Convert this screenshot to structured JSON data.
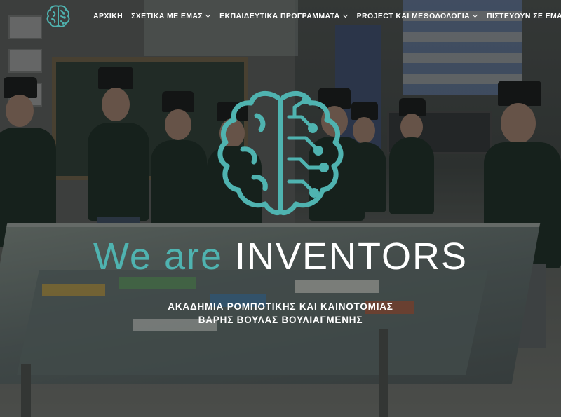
{
  "nav": {
    "items": [
      {
        "label": "ΑΡΧΙΚΗ",
        "has_dropdown": false
      },
      {
        "label": "ΣΧΕΤΙΚΑ ΜΕ ΕΜΑΣ",
        "has_dropdown": true
      },
      {
        "label": "ΕΚΠΑΙΔΕΥΤΙΚΑ ΠΡΟΓΡΑΜΜΑΤΑ",
        "has_dropdown": true
      },
      {
        "label": "PROJECT ΚΑΙ ΜΕΘΟΔΟΛΟΓΙΑ",
        "has_dropdown": true
      },
      {
        "label": "ΠΙΣΤΕΥΟΥΝ ΣΕ ΕΜΑΣ",
        "has_dropdown": false
      }
    ]
  },
  "hero": {
    "headline_part1": "We are",
    "headline_part2": "INVENTORS",
    "subtitle_line1": "ΑΚΑΔΗΜΙΑ ΡΟΜΠΟΤΙΚΗΣ ΚΑΙ ΚΑΙΝΟΤΟΜΙΑΣ",
    "subtitle_line2": "ΒΑΡΗΣ ΒΟΥΛΑΣ ΒΟΥΛΙΑΓΜΕΝΗΣ",
    "background_image": "students-in-top-hats-around-robotics-competition-table"
  },
  "colors": {
    "accent_teal": "#4fb3b0",
    "text_white": "#ffffff",
    "overlay": "rgba(15,18,18,0.38)"
  },
  "icons": {
    "logo": "brain-circuit-icon",
    "hero_graphic": "brain-circuit-icon",
    "dropdown": "chevron-down-icon"
  }
}
